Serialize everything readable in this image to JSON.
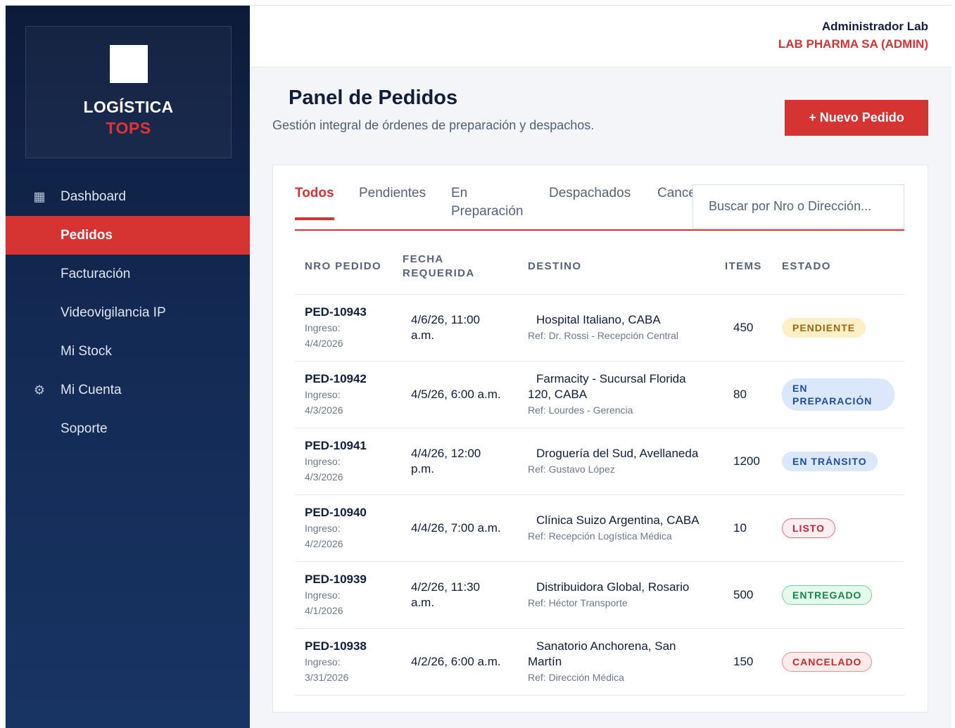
{
  "brand": {
    "name": "LOGÍSTICA",
    "sub": "TOPS"
  },
  "sidebar": {
    "items": [
      {
        "label": "Dashboard",
        "icon": "▦"
      },
      {
        "label": "Pedidos",
        "icon": ""
      },
      {
        "label": "Facturación",
        "icon": ""
      },
      {
        "label": "Videovigilancia IP",
        "icon": ""
      },
      {
        "label": "Mi Stock",
        "icon": ""
      },
      {
        "label": "Mi Cuenta",
        "icon": "⚙"
      },
      {
        "label": "Soporte",
        "icon": ""
      }
    ]
  },
  "header": {
    "user": "Administrador Lab",
    "org": "LAB PHARMA SA (ADMIN)"
  },
  "page": {
    "title": "Panel de Pedidos",
    "subtitle": "Gestión integral de órdenes de preparación y despachos.",
    "new_button": "+ Nuevo Pedido"
  },
  "tabs": [
    {
      "label": "Todos"
    },
    {
      "label": "Pendientes"
    },
    {
      "label": "En Preparación"
    },
    {
      "label": "Despachados"
    },
    {
      "label": "Cancelados"
    }
  ],
  "search": {
    "placeholder": "Buscar por Nro o Dirección..."
  },
  "table": {
    "headers": [
      "NRO PEDIDO",
      "FECHA REQUERIDA",
      "DESTINO",
      "ITEMS",
      "ESTADO"
    ],
    "rows": [
      {
        "id": "PED-10943",
        "ingreso_label": "Ingreso:",
        "ingreso": "4/4/2026",
        "fecha": "4/6/26, 11:00 a.m.",
        "destino": "Hospital Italiano, CABA",
        "ref": "Ref: Dr. Rossi - Recepción Central",
        "items": "450",
        "estado": "PENDIENTE"
      },
      {
        "id": "PED-10942",
        "ingreso_label": "Ingreso:",
        "ingreso": "4/3/2026",
        "fecha": "4/5/26, 6:00 a.m.",
        "destino": "Farmacity - Sucursal Florida 120, CABA",
        "ref": "Ref: Lourdes - Gerencia",
        "items": "80",
        "estado": "EN PREPARACIÓN"
      },
      {
        "id": "PED-10941",
        "ingreso_label": "Ingreso:",
        "ingreso": "4/3/2026",
        "fecha": "4/4/26, 12:00 p.m.",
        "destino": "Droguería del Sud, Avellaneda",
        "ref": "Ref: Gustavo López",
        "items": "1200",
        "estado": "EN TRÁNSITO"
      },
      {
        "id": "PED-10940",
        "ingreso_label": "Ingreso:",
        "ingreso": "4/2/2026",
        "fecha": "4/4/26, 7:00 a.m.",
        "destino": "Clínica Suizo Argentina, CABA",
        "ref": "Ref: Recepción Logística Médica",
        "items": "10",
        "estado": "LISTO"
      },
      {
        "id": "PED-10939",
        "ingreso_label": "Ingreso:",
        "ingreso": "4/1/2026",
        "fecha": "4/2/26, 11:30 a.m.",
        "destino": "Distribuidora Global, Rosario",
        "ref": "Ref: Héctor Transporte",
        "items": "500",
        "estado": "ENTREGADO"
      },
      {
        "id": "PED-10938",
        "ingreso_label": "Ingreso:",
        "ingreso": "3/31/2026",
        "fecha": "4/2/26, 6:00 a.m.",
        "destino": "Sanatorio Anchorena, San Martín",
        "ref": "Ref: Dirección Médica",
        "items": "150",
        "estado": "CANCELADO"
      }
    ]
  },
  "colors": {
    "primary_red": "#d63333",
    "sidebar_navy": "#132a54",
    "text_dark": "#0f1e3d"
  }
}
